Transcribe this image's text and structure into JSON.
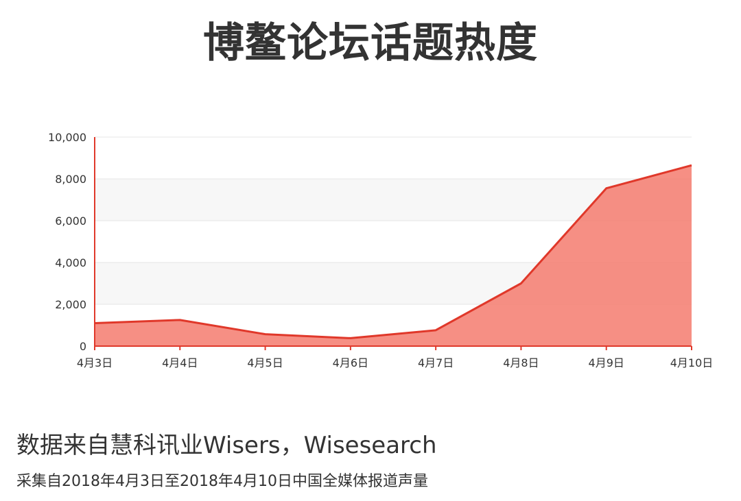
{
  "title": "博鳌论坛话题热度",
  "source_line": "数据来自慧科讯业Wisers，Wisesearch",
  "note_line": "采集自2018年4月3日至2018年4月10日中国全媒体报道声量",
  "colors": {
    "line": "#e0382a",
    "area": "#f47b6f",
    "band": "#f7f7f7",
    "grid": "#e6e6e6",
    "text": "#333333"
  },
  "chart_data": {
    "type": "area",
    "categories": [
      "4月3日",
      "4月4日",
      "4月5日",
      "4月6日",
      "4月7日",
      "4月8日",
      "4月9日",
      "4月10日"
    ],
    "values": [
      1100,
      1250,
      570,
      380,
      760,
      3000,
      7550,
      8650
    ],
    "ylim": [
      0,
      10000
    ],
    "yticks": [
      0,
      2000,
      4000,
      6000,
      8000,
      10000
    ],
    "ytick_labels": [
      "0",
      "2,000",
      "4,000",
      "6,000",
      "8,000",
      "10,000"
    ],
    "grid": true,
    "title": "",
    "xlabel": "",
    "ylabel": ""
  }
}
